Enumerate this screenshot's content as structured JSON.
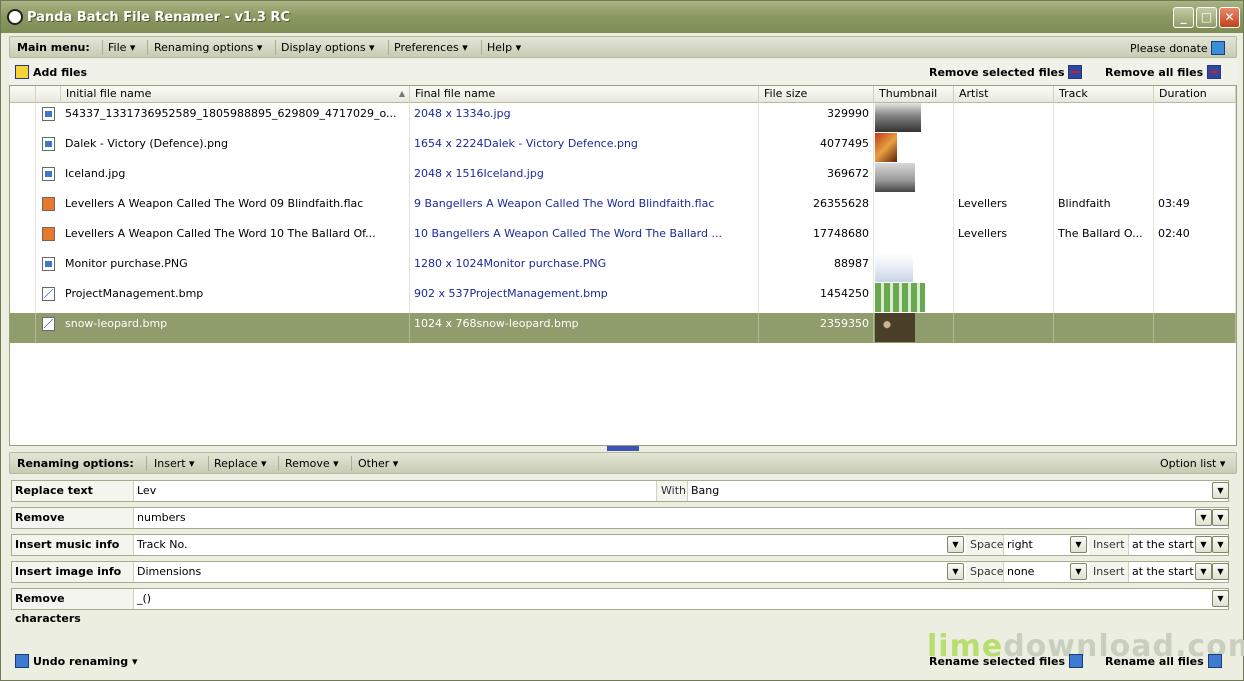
{
  "window": {
    "title": "Panda Batch File Renamer - v1.3 RC"
  },
  "menu": {
    "label": "Main menu:",
    "items": [
      "File",
      "Renaming options",
      "Display options",
      "Preferences",
      "Help"
    ],
    "donate": "Please donate"
  },
  "toolbar": {
    "add": "Add files",
    "remove_selected": "Remove selected files",
    "remove_all": "Remove all files"
  },
  "columns": [
    "Initial file name",
    "Final file name",
    "File size",
    "Thumbnail",
    "Artist",
    "Track",
    "Duration"
  ],
  "files": [
    {
      "icon": "img",
      "initial": "54337_1331736952589_1805988895_629809_4717029_o...",
      "final": "2048 x 1334o.jpg",
      "size": "329990",
      "artist": "",
      "track": "",
      "duration": "",
      "thumb": "dark"
    },
    {
      "icon": "img",
      "initial": "Dalek - Victory (Defence).png",
      "final": "1654 x 2224Dalek - Victory Defence.png",
      "size": "4077495",
      "artist": "",
      "track": "",
      "duration": "",
      "thumb": "red"
    },
    {
      "icon": "img",
      "initial": "Iceland.jpg",
      "final": "2048 x 1516Iceland.jpg",
      "size": "369672",
      "artist": "",
      "track": "",
      "duration": "",
      "thumb": "grey"
    },
    {
      "icon": "audio",
      "initial": "Levellers  A Weapon Called The Word  09  Blindfaith.flac",
      "final": "9 Bangellers  A Weapon Called The Word    Blindfaith.flac",
      "size": "26355628",
      "artist": "Levellers",
      "track": "Blindfaith",
      "duration": "03:49",
      "thumb": ""
    },
    {
      "icon": "audio",
      "initial": "Levellers  A Weapon Called The Word  10  The Ballard Of...",
      "final": "10 Bangellers  A Weapon Called The Word    The Ballard ...",
      "size": "17748680",
      "artist": "Levellers",
      "track": "The Ballard O...",
      "duration": "02:40",
      "thumb": ""
    },
    {
      "icon": "img",
      "initial": "Monitor purchase.PNG",
      "final": "1280 x 1024Monitor purchase.PNG",
      "size": "88987",
      "artist": "",
      "track": "",
      "duration": "",
      "thumb": "light"
    },
    {
      "icon": "bmp",
      "initial": "ProjectManagement.bmp",
      "final": "902 x 537ProjectManagement.bmp",
      "size": "1454250",
      "artist": "",
      "track": "",
      "duration": "",
      "thumb": "green"
    },
    {
      "icon": "bmp",
      "initial": "snow-leopard.bmp",
      "final": "1024 x 768snow-leopard.bmp",
      "size": "2359350",
      "artist": "",
      "track": "",
      "duration": "",
      "thumb": "leopard",
      "selected": true
    }
  ],
  "options_bar": {
    "label": "Renaming options:",
    "items": [
      "Insert",
      "Replace",
      "Remove",
      "Other"
    ],
    "list": "Option list"
  },
  "options": {
    "replace": {
      "label": "Replace text",
      "value": "Lev",
      "with_label": "With",
      "with_value": "Bang"
    },
    "remove": {
      "label": "Remove",
      "value": "numbers"
    },
    "music": {
      "label": "Insert music info",
      "value": "Track No.",
      "space_label": "Space",
      "space_value": "right",
      "insert_label": "Insert",
      "insert_value": "at the start"
    },
    "image": {
      "label": "Insert image info",
      "value": "Dimensions",
      "space_label": "Space",
      "space_value": "none",
      "insert_label": "Insert",
      "insert_value": "at the start"
    },
    "chars": {
      "label": "Remove characters",
      "value": "_()"
    }
  },
  "footer": {
    "undo": "Undo renaming",
    "rename_selected": "Rename selected files",
    "rename_all": "Rename all files"
  },
  "watermark": {
    "a": "lime",
    "b": "download.com"
  }
}
